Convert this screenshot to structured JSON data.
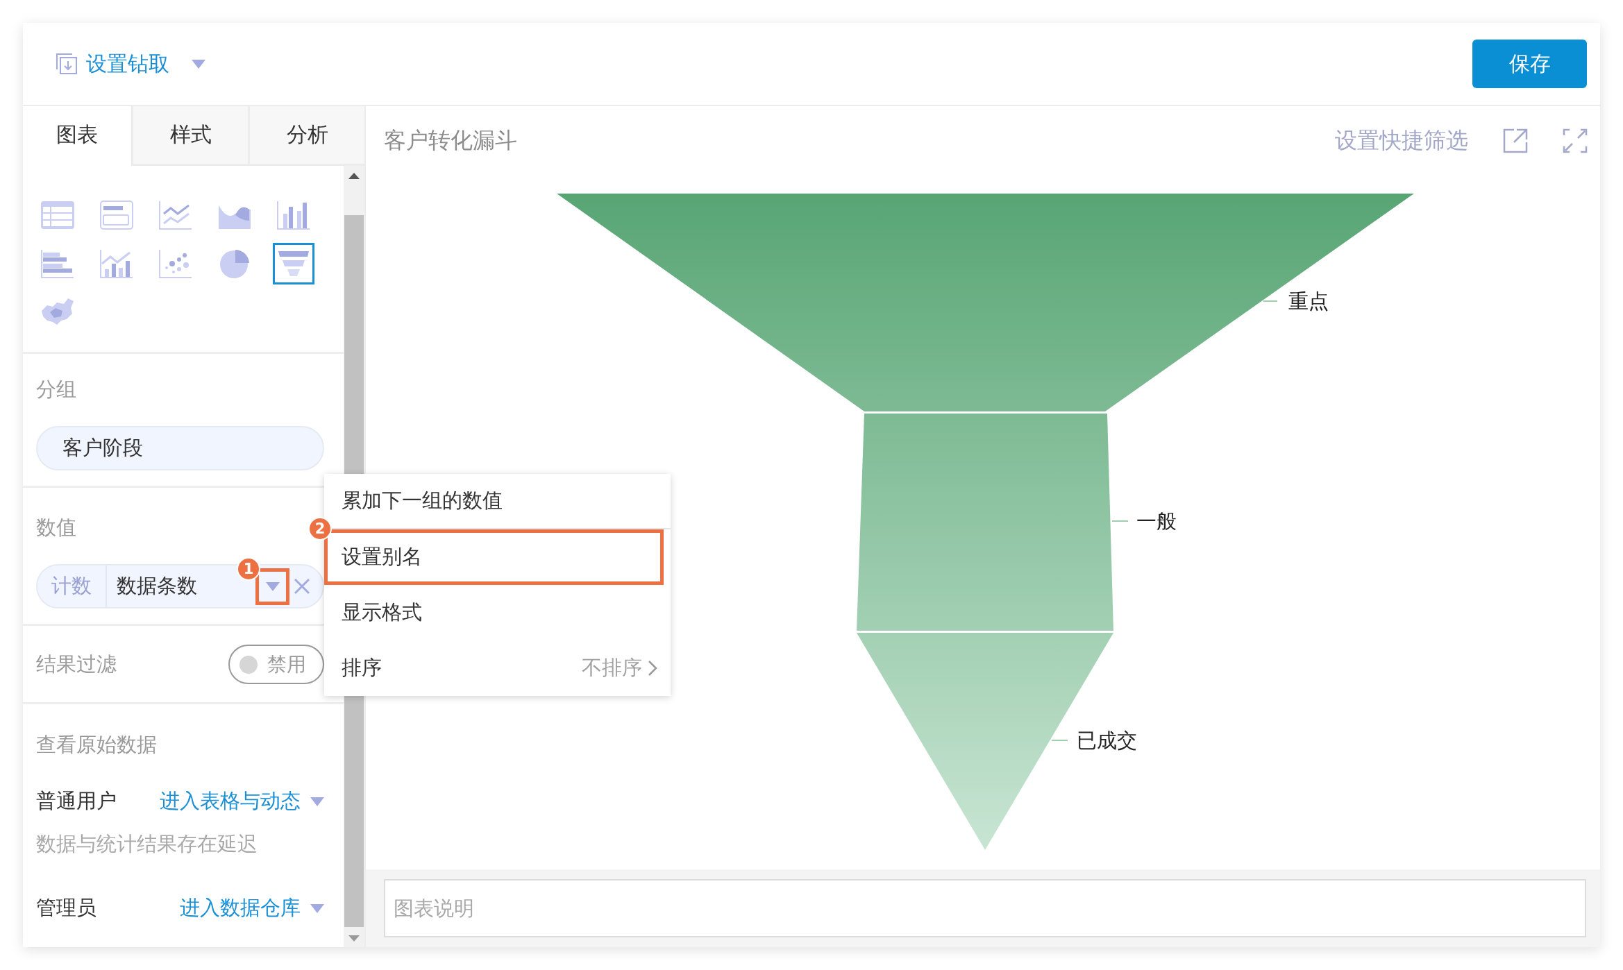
{
  "header": {
    "title": "设置钻取",
    "save_button": "保存"
  },
  "tabs": [
    {
      "label": "图表",
      "selected": true
    },
    {
      "label": "样式",
      "selected": false
    },
    {
      "label": "分析",
      "selected": false
    }
  ],
  "chart_types": [
    {
      "kind": "table",
      "selected": false
    },
    {
      "kind": "number",
      "selected": false
    },
    {
      "kind": "line",
      "selected": false
    },
    {
      "kind": "area",
      "selected": false
    },
    {
      "kind": "bar",
      "selected": false
    },
    {
      "kind": "hbar",
      "selected": false
    },
    {
      "kind": "combo",
      "selected": false
    },
    {
      "kind": "scatter",
      "selected": false
    },
    {
      "kind": "pie",
      "selected": false
    },
    {
      "kind": "funnel",
      "selected": true
    },
    {
      "kind": "map",
      "selected": false
    }
  ],
  "group": {
    "label": "分组",
    "field": "客户阶段"
  },
  "value": {
    "label": "数值",
    "aggregation": "计数",
    "field": "数据条数",
    "caret_badge": "1"
  },
  "result_filter": {
    "label": "结果过滤",
    "toggle_label": "禁用",
    "on": false
  },
  "raw_data": {
    "label": "查看原始数据",
    "normal_user": {
      "role": "普通用户",
      "link": "进入表格与动态"
    },
    "note": "数据与统计结果存在延迟",
    "admin": {
      "role": "管理员",
      "link": "进入数据仓库"
    }
  },
  "chart_panel": {
    "title": "客户转化漏斗",
    "quick_filter": "设置快捷筛选",
    "stages": [
      {
        "label": "重点"
      },
      {
        "label": "一般"
      },
      {
        "label": "已成交"
      }
    ],
    "description_placeholder": "图表说明"
  },
  "menu": {
    "items": [
      {
        "label": "累加下一组的数值",
        "selected": false
      },
      {
        "label": "设置别名",
        "badge": "2",
        "selected": true
      },
      {
        "label": "显示格式",
        "selected": false
      },
      {
        "label": "排序",
        "value": "不排序",
        "selected": false
      }
    ]
  }
}
